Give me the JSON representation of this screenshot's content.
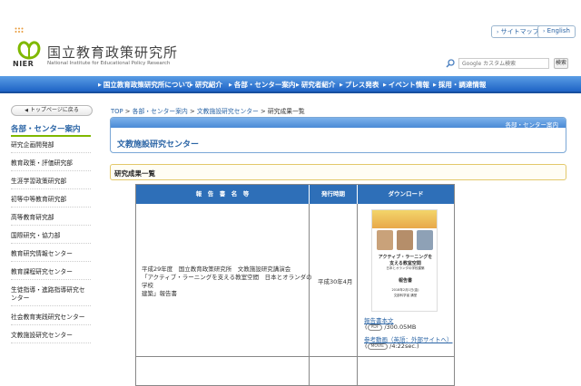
{
  "header": {
    "org_name": "国立教育政策研究所",
    "org_name_en": "National Institute for Educational Policy Research",
    "logo_text": "NIER",
    "sitemap_label": "サイトマップ",
    "english_label": "English",
    "search": {
      "placeholder": "Google カスタム検索",
      "button_label": "検索"
    }
  },
  "nav": {
    "items": [
      "国立教育政策研究所について",
      "研究紹介",
      "各部・センター案内",
      "研究者紹介",
      "プレス発表",
      "イベント情報",
      "採用・調達情報"
    ]
  },
  "sidebar": {
    "back_label": "トップページに戻る",
    "title": "各部・センター案内",
    "items": [
      "研究企画開発部",
      "教育政策・評価研究部",
      "生涯学習政策研究部",
      "初等中等教育研究部",
      "高等教育研究部",
      "国際研究・協力部",
      "教育研究情報センター",
      "教育課程研究センター",
      "生徒指導・進路指導研究センター",
      "社会教育実践研究センター",
      "文教施設研究センター"
    ]
  },
  "breadcrumb": {
    "items": [
      "TOP",
      "各部・センター案内",
      "文教施設研究センター"
    ],
    "current": "研究成果一覧",
    "separator": ">"
  },
  "panel": {
    "sub_link": "各部・センター案内",
    "title": "文教施設研究センター"
  },
  "section": {
    "title": "研究成果一覧"
  },
  "table": {
    "headers": [
      "報　告　書　名　等",
      "発行時期",
      "ダウンロード"
    ],
    "rows": [
      {
        "name_lines": [
          "平成29年度　国立教育政策研究所　文教施設研究講演会",
          "「アクティブ・ラーニングを支える教室空間　日本とオランダの学校",
          "建築」報告書"
        ],
        "date": "平成30年4月",
        "cover": {
          "title": "アクティブ・ラーニングを",
          "title2": "支える教室空間",
          "subtitle": "日本とオランダの学校建築",
          "label": "報告書",
          "date": "2018年2月1日(金)",
          "org": "文部科学省 講堂"
        },
        "downloads": [
          {
            "label": "報告書本文",
            "type": "PDF",
            "size": "/300.05MB"
          },
          {
            "label": "参考動画（英語：外部サイトへ）",
            "type": "MOVIE",
            "size": "/4:22sec.)"
          }
        ]
      }
    ]
  },
  "colors": {
    "nav_blue": "#1e63c5",
    "link_blue": "#2a64a5",
    "accent_green": "#7fb800",
    "header_cell": "#2e6fb8"
  }
}
